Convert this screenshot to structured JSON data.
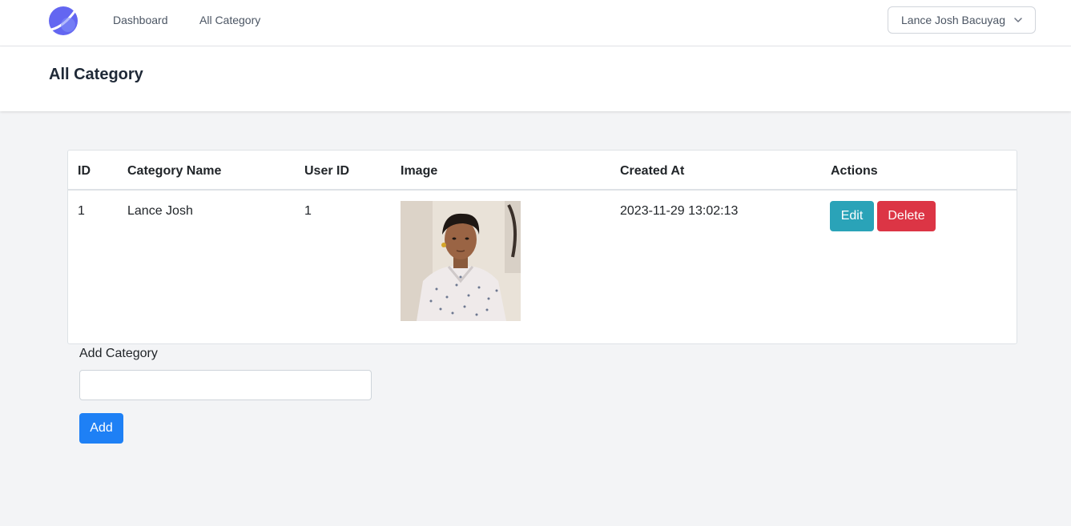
{
  "nav": {
    "logo_icon": "app-logo-icon",
    "links": [
      "Dashboard",
      "All Category"
    ],
    "user_name": "Lance Josh Bacuyag",
    "user_chevron_icon": "chevron-down-icon"
  },
  "header": {
    "title": "All Category"
  },
  "table": {
    "columns": [
      "ID",
      "Category Name",
      "User ID",
      "Image",
      "Created At",
      "Actions"
    ],
    "rows": [
      {
        "id": "1",
        "category_name": "Lance Josh",
        "user_id": "1",
        "image": "profile-photo",
        "created_at": "2023-11-29 13:02:13",
        "edit_label": "Edit",
        "delete_label": "Delete"
      }
    ]
  },
  "form": {
    "label": "Add Category",
    "input_value": "",
    "add_label": "Add"
  },
  "colors": {
    "accent": "#1e80f5",
    "edit": "#2aa3b8",
    "delete": "#dc3545",
    "logo": "#6366f1"
  }
}
